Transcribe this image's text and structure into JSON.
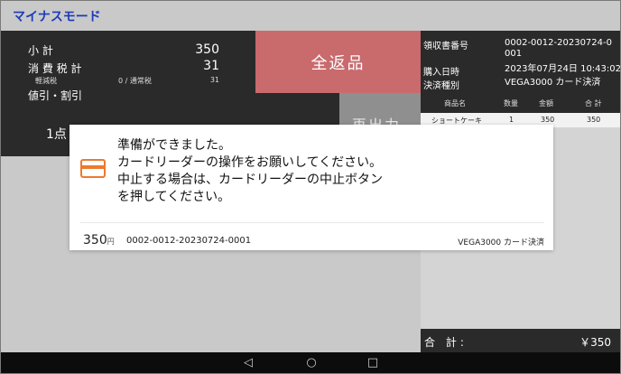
{
  "header": {
    "title": "マイナスモード"
  },
  "summary": {
    "subtotal_label": "小 計",
    "subtotal_value": "350",
    "tax_label": "消 費 税 計",
    "tax_value": "31",
    "reduced_label": "軽減税",
    "reduced_mid": "0 / 通常税",
    "reduced_value": "31",
    "discount_label": "値引・割引",
    "item_count": "1点"
  },
  "actions": {
    "return_all": "全返品",
    "reissue": "再出力"
  },
  "receipt": {
    "number_label": "領収書番号",
    "number_value": "0002-0012-20230724-0001",
    "date_label": "購入日時",
    "date_value": "2023年07月24日 10:43:02",
    "payment_label": "決済種別",
    "payment_value": "VEGA3000 カード決済",
    "columns": [
      "商品名",
      "数量",
      "金額",
      "合 計"
    ],
    "items": [
      {
        "name": "ショートケーキ",
        "qty": "1",
        "price": "350",
        "total": "350"
      }
    ]
  },
  "total": {
    "label": "合 計:",
    "value": "￥350"
  },
  "dialog": {
    "lines": [
      "準備ができました。",
      "カードリーダーの操作をお願いしてください。",
      "中止する場合は、カードリーダーの中止ボタン",
      "を押してください。"
    ],
    "amount": "350",
    "yen": "円",
    "receipt_number": "0002-0012-20230724-0001",
    "payment_method": "VEGA3000 カード決済"
  },
  "navbar": {
    "back": "◁",
    "home": "○",
    "recents": "□"
  },
  "colors": {
    "accent_blue": "#1d3bb8",
    "return_button": "#c96a6d",
    "card_icon": "#ee7a2e",
    "panel_dark": "#2a2a2a"
  }
}
